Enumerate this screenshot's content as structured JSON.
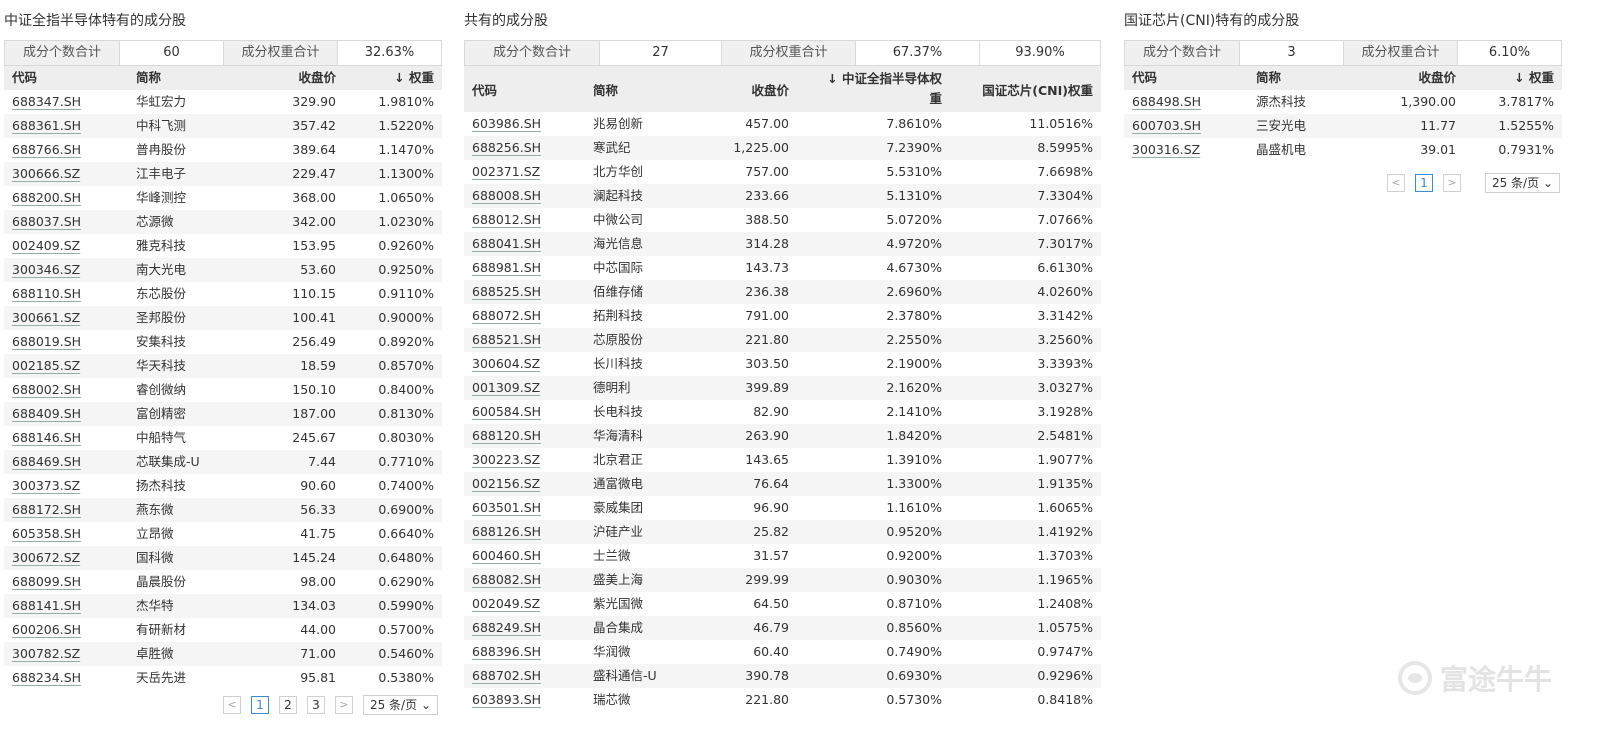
{
  "panel1": {
    "title": "中证全指半导体特有的成分股",
    "summary": {
      "count_label": "成分个数合计",
      "count_value": "60",
      "weight_label": "成分权重合计",
      "weight_value": "32.63%"
    },
    "headers": {
      "code": "代码",
      "name": "简称",
      "price": "收盘价",
      "weight": "↓ 权重"
    },
    "rows": [
      {
        "code": "688347.SH",
        "name": "华虹宏力",
        "price": "329.90",
        "weight": "1.9810%"
      },
      {
        "code": "688361.SH",
        "name": "中科飞测",
        "price": "357.42",
        "weight": "1.5220%"
      },
      {
        "code": "688766.SH",
        "name": "普冉股份",
        "price": "389.64",
        "weight": "1.1470%"
      },
      {
        "code": "300666.SZ",
        "name": "江丰电子",
        "price": "229.47",
        "weight": "1.1300%"
      },
      {
        "code": "688200.SH",
        "name": "华峰测控",
        "price": "368.00",
        "weight": "1.0650%"
      },
      {
        "code": "688037.SH",
        "name": "芯源微",
        "price": "342.00",
        "weight": "1.0230%"
      },
      {
        "code": "002409.SZ",
        "name": "雅克科技",
        "price": "153.95",
        "weight": "0.9260%"
      },
      {
        "code": "300346.SZ",
        "name": "南大光电",
        "price": "53.60",
        "weight": "0.9250%"
      },
      {
        "code": "688110.SH",
        "name": "东芯股份",
        "price": "110.15",
        "weight": "0.9110%"
      },
      {
        "code": "300661.SZ",
        "name": "圣邦股份",
        "price": "100.41",
        "weight": "0.9000%"
      },
      {
        "code": "688019.SH",
        "name": "安集科技",
        "price": "256.49",
        "weight": "0.8920%"
      },
      {
        "code": "002185.SZ",
        "name": "华天科技",
        "price": "18.59",
        "weight": "0.8570%"
      },
      {
        "code": "688002.SH",
        "name": "睿创微纳",
        "price": "150.10",
        "weight": "0.8400%"
      },
      {
        "code": "688409.SH",
        "name": "富创精密",
        "price": "187.00",
        "weight": "0.8130%"
      },
      {
        "code": "688146.SH",
        "name": "中船特气",
        "price": "245.67",
        "weight": "0.8030%"
      },
      {
        "code": "688469.SH",
        "name": "芯联集成-U",
        "price": "7.44",
        "weight": "0.7710%"
      },
      {
        "code": "300373.SZ",
        "name": "扬杰科技",
        "price": "90.60",
        "weight": "0.7400%"
      },
      {
        "code": "688172.SH",
        "name": "燕东微",
        "price": "56.33",
        "weight": "0.6900%"
      },
      {
        "code": "605358.SH",
        "name": "立昂微",
        "price": "41.75",
        "weight": "0.6640%"
      },
      {
        "code": "300672.SZ",
        "name": "国科微",
        "price": "145.24",
        "weight": "0.6480%"
      },
      {
        "code": "688099.SH",
        "name": "晶晨股份",
        "price": "98.00",
        "weight": "0.6290%"
      },
      {
        "code": "688141.SH",
        "name": "杰华特",
        "price": "134.03",
        "weight": "0.5990%"
      },
      {
        "code": "600206.SH",
        "name": "有研新材",
        "price": "44.00",
        "weight": "0.5700%"
      },
      {
        "code": "300782.SZ",
        "name": "卓胜微",
        "price": "71.00",
        "weight": "0.5460%"
      },
      {
        "code": "688234.SH",
        "name": "天岳先进",
        "price": "95.81",
        "weight": "0.5380%"
      }
    ],
    "pager": {
      "prev": "<",
      "next": ">",
      "pages": [
        "1",
        "2",
        "3"
      ],
      "size": "25 条/页"
    }
  },
  "panel2": {
    "title": "共有的成分股",
    "summary": {
      "count_label": "成分个数合计",
      "count_value": "27",
      "weight_label": "成分权重合计",
      "weight_value": "67.37%",
      "weight_value2": "93.90%"
    },
    "headers": {
      "code": "代码",
      "name": "简称",
      "price": "收盘价",
      "weight1": "↓ 中证全指半导体权重",
      "weight2": "国证芯片(CNI)权重"
    },
    "rows": [
      {
        "code": "603986.SH",
        "name": "兆易创新",
        "price": "457.00",
        "w1": "7.8610%",
        "w2": "11.0516%"
      },
      {
        "code": "688256.SH",
        "name": "寒武纪",
        "price": "1,225.00",
        "w1": "7.2390%",
        "w2": "8.5995%"
      },
      {
        "code": "002371.SZ",
        "name": "北方华创",
        "price": "757.00",
        "w1": "5.5310%",
        "w2": "7.6698%"
      },
      {
        "code": "688008.SH",
        "name": "澜起科技",
        "price": "233.66",
        "w1": "5.1310%",
        "w2": "7.3304%"
      },
      {
        "code": "688012.SH",
        "name": "中微公司",
        "price": "388.50",
        "w1": "5.0720%",
        "w2": "7.0766%"
      },
      {
        "code": "688041.SH",
        "name": "海光信息",
        "price": "314.28",
        "w1": "4.9720%",
        "w2": "7.3017%"
      },
      {
        "code": "688981.SH",
        "name": "中芯国际",
        "price": "143.73",
        "w1": "4.6730%",
        "w2": "6.6130%"
      },
      {
        "code": "688525.SH",
        "name": "佰维存储",
        "price": "236.38",
        "w1": "2.6960%",
        "w2": "4.0260%"
      },
      {
        "code": "688072.SH",
        "name": "拓荆科技",
        "price": "791.00",
        "w1": "2.3780%",
        "w2": "3.3142%"
      },
      {
        "code": "688521.SH",
        "name": "芯原股份",
        "price": "221.80",
        "w1": "2.2550%",
        "w2": "3.2560%"
      },
      {
        "code": "300604.SZ",
        "name": "长川科技",
        "price": "303.50",
        "w1": "2.1900%",
        "w2": "3.3393%"
      },
      {
        "code": "001309.SZ",
        "name": "德明利",
        "price": "399.89",
        "w1": "2.1620%",
        "w2": "3.0327%"
      },
      {
        "code": "600584.SH",
        "name": "长电科技",
        "price": "82.90",
        "w1": "2.1410%",
        "w2": "3.1928%"
      },
      {
        "code": "688120.SH",
        "name": "华海清科",
        "price": "263.90",
        "w1": "1.8420%",
        "w2": "2.5481%"
      },
      {
        "code": "300223.SZ",
        "name": "北京君正",
        "price": "143.65",
        "w1": "1.3910%",
        "w2": "1.9077%"
      },
      {
        "code": "002156.SZ",
        "name": "通富微电",
        "price": "76.64",
        "w1": "1.3300%",
        "w2": "1.9135%"
      },
      {
        "code": "603501.SH",
        "name": "豪威集团",
        "price": "96.90",
        "w1": "1.1610%",
        "w2": "1.6065%"
      },
      {
        "code": "688126.SH",
        "name": "沪硅产业",
        "price": "25.82",
        "w1": "0.9520%",
        "w2": "1.4192%"
      },
      {
        "code": "600460.SH",
        "name": "士兰微",
        "price": "31.57",
        "w1": "0.9200%",
        "w2": "1.3703%"
      },
      {
        "code": "688082.SH",
        "name": "盛美上海",
        "price": "299.99",
        "w1": "0.9030%",
        "w2": "1.1965%"
      },
      {
        "code": "002049.SZ",
        "name": "紫光国微",
        "price": "64.50",
        "w1": "0.8710%",
        "w2": "1.2408%"
      },
      {
        "code": "688249.SH",
        "name": "晶合集成",
        "price": "46.79",
        "w1": "0.8560%",
        "w2": "1.0575%"
      },
      {
        "code": "688396.SH",
        "name": "华润微",
        "price": "60.40",
        "w1": "0.7490%",
        "w2": "0.9747%"
      },
      {
        "code": "688702.SH",
        "name": "盛科通信-U",
        "price": "390.78",
        "w1": "0.6930%",
        "w2": "0.9296%"
      },
      {
        "code": "603893.SH",
        "name": "瑞芯微",
        "price": "221.80",
        "w1": "0.5730%",
        "w2": "0.8418%"
      }
    ]
  },
  "panel3": {
    "title": "国证芯片(CNI)特有的成分股",
    "summary": {
      "count_label": "成分个数合计",
      "count_value": "3",
      "weight_label": "成分权重合计",
      "weight_value": "6.10%"
    },
    "headers": {
      "code": "代码",
      "name": "简称",
      "price": "收盘价",
      "weight": "↓ 权重"
    },
    "rows": [
      {
        "code": "688498.SH",
        "name": "源杰科技",
        "price": "1,390.00",
        "weight": "3.7817%"
      },
      {
        "code": "600703.SH",
        "name": "三安光电",
        "price": "11.77",
        "weight": "1.5255%"
      },
      {
        "code": "300316.SZ",
        "name": "晶盛机电",
        "price": "39.01",
        "weight": "0.7931%"
      }
    ],
    "pager": {
      "prev": "<",
      "next": ">",
      "pages": [
        "1"
      ],
      "size": "25 条/页"
    }
  },
  "watermark": {
    "text": "富途牛牛"
  }
}
